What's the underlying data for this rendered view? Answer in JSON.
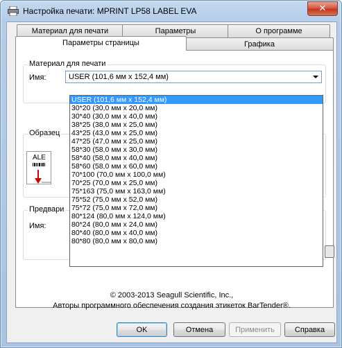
{
  "window": {
    "title": "Настройка печати: MPRINT LP58 LABEL EVA",
    "close_glyph": "✕"
  },
  "tabs": {
    "row1": [
      "Материал для печати",
      "Параметры",
      "О программе"
    ],
    "row2": [
      "Параметры страницы",
      "Графика"
    ],
    "active": "Параметры страницы"
  },
  "media_group": {
    "label": "Материал для печати",
    "name_label": "Имя:",
    "selected_value": "USER (101,6 мм x 152,4 мм)"
  },
  "dropdown": {
    "options": [
      "USER (101,6 мм x 152,4 мм)",
      "30*20 (30,0 мм x 20,0 мм)",
      "30*40 (30,0 мм x 40,0 мм)",
      "38*25 (38,0 мм x 25,0 мм)",
      "43*25 (43,0 мм x 25,0 мм)",
      "47*25 (47,0 мм x 25,0 мм)",
      "58*30 (58,0 мм x 30,0 мм)",
      "58*40 (58,0 мм x 40,0 мм)",
      "58*60 (58,0 мм x 60,0 мм)",
      "70*100 (70,0 мм x 100,0 мм)",
      "70*25 (70,0 мм x 25,0 мм)",
      "75*163 (75,0 мм x 163,0 мм)",
      "75*52 (75,0 мм x 52,0 мм)",
      "75*72 (75,0 мм x 72,0 мм)",
      "80*124 (80,0 мм x 124,0 мм)",
      "80*24 (80,0 мм x 24,0 мм)",
      "80*40 (80,0 мм x 40,0 мм)",
      "80*80 (80,0 мм x 80,0 мм)"
    ],
    "highlighted_index": 0
  },
  "sample_group": {
    "label": "Образец",
    "sample_text": "ALE"
  },
  "preset_group": {
    "label": "Предвари",
    "name_label": "Имя:"
  },
  "footer": {
    "copyright": "© 2003-2013 Seagull Scientific, Inc.,",
    "authors": "Авторы программного обеспечения создания этикеток BarTender®."
  },
  "buttons": {
    "ok": "OK",
    "cancel": "Отмена",
    "apply": "Применить",
    "help": "Справка"
  },
  "colors": {
    "selection": "#3399ff",
    "close_button": "#c4361f"
  }
}
